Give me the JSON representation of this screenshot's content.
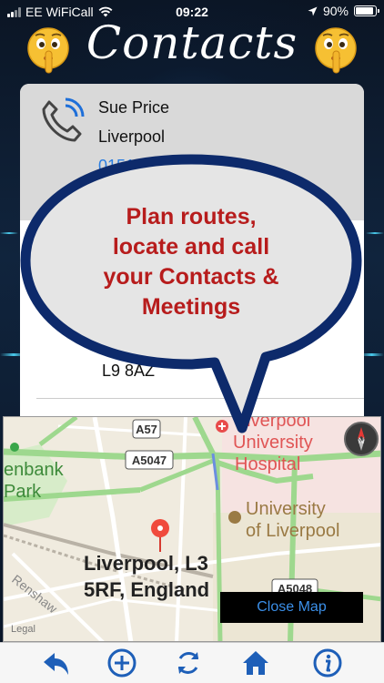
{
  "status_bar": {
    "carrier": "EE WiFiCall",
    "time": "09:22",
    "battery": "90%",
    "battery_level": 0.9
  },
  "header": {
    "title": "Contacts",
    "left_icon": "shushing-face-emoji",
    "right_icon": "shushing-face-emoji"
  },
  "contact": {
    "name": "Sue Price",
    "city": "Liverpool",
    "phone": "01515325555",
    "postcode": "L9 8AZ",
    "icon": "phone-call-icon"
  },
  "promo_bubble": {
    "lines": [
      "Plan routes,",
      "locate and call",
      "your Contacts &",
      "Meetings"
    ],
    "text_color": "#b71c1c",
    "border_color": "#0d2a6b"
  },
  "map": {
    "road_labels": [
      "A57",
      "A5047",
      "A5048"
    ],
    "place_labels": {
      "park_a": "enbank",
      "park_b": "Park",
      "hospital_a": "Liverpool",
      "hospital_b": "University",
      "hospital_c": "Hospital",
      "university_a": "University",
      "university_b": "of Liverpool",
      "street": "Renshaw"
    },
    "pin_label_line1": "Liverpool, L3",
    "pin_label_line2": "5RF, England",
    "legal": "Legal",
    "compass_label": "N",
    "close_button": "Close Map"
  },
  "toolbar": {
    "items": [
      "back-icon",
      "add-icon",
      "refresh-icon",
      "home-icon",
      "info-icon"
    ],
    "icon_color": "#1e5fb8"
  }
}
